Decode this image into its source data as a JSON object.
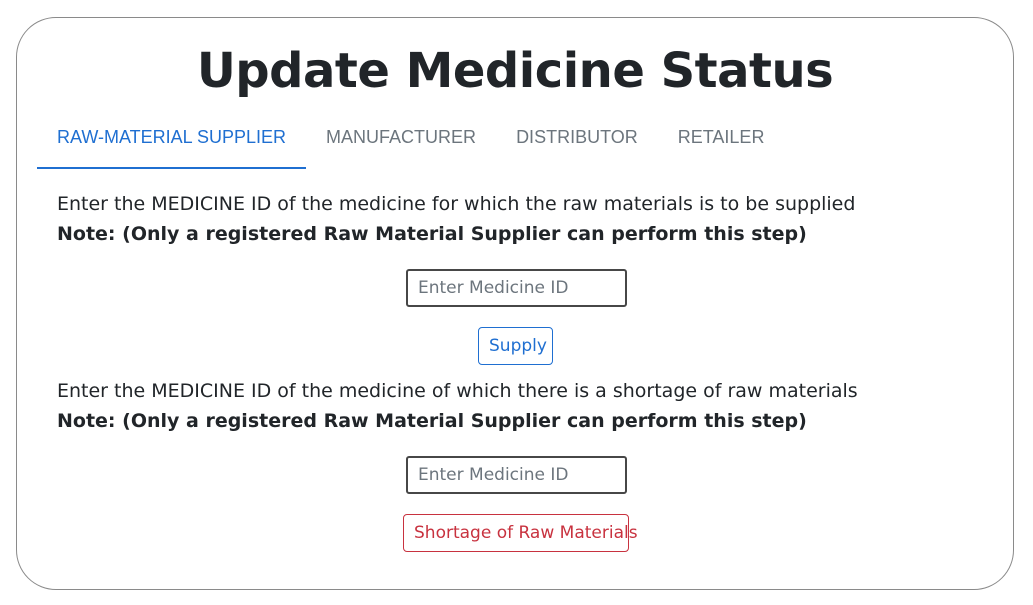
{
  "page": {
    "title": "Update Medicine Status"
  },
  "tabs": [
    {
      "label": "RAW-MATERIAL SUPPLIER",
      "active": true
    },
    {
      "label": "MANUFACTURER",
      "active": false
    },
    {
      "label": "DISTRIBUTOR",
      "active": false
    },
    {
      "label": "RETAILER",
      "active": false
    }
  ],
  "supply_section": {
    "description": "Enter the MEDICINE ID of the medicine for which the raw materials is to be supplied",
    "note": "Note: (Only a registered Raw Material Supplier can perform this step)",
    "input_placeholder": "Enter Medicine ID",
    "input_value": "",
    "button_label": "Supply"
  },
  "shortage_section": {
    "description": "Enter the MEDICINE ID of the medicine of which there is a shortage of raw materials",
    "note": "Note: (Only a registered Raw Material Supplier can perform this step)",
    "input_placeholder": "Enter Medicine ID",
    "input_value": "",
    "button_label": "Shortage of Raw Materials"
  },
  "colors": {
    "primary": "#1f6fd1",
    "danger": "#c8323f",
    "text": "#212529",
    "muted": "#6c757d"
  }
}
